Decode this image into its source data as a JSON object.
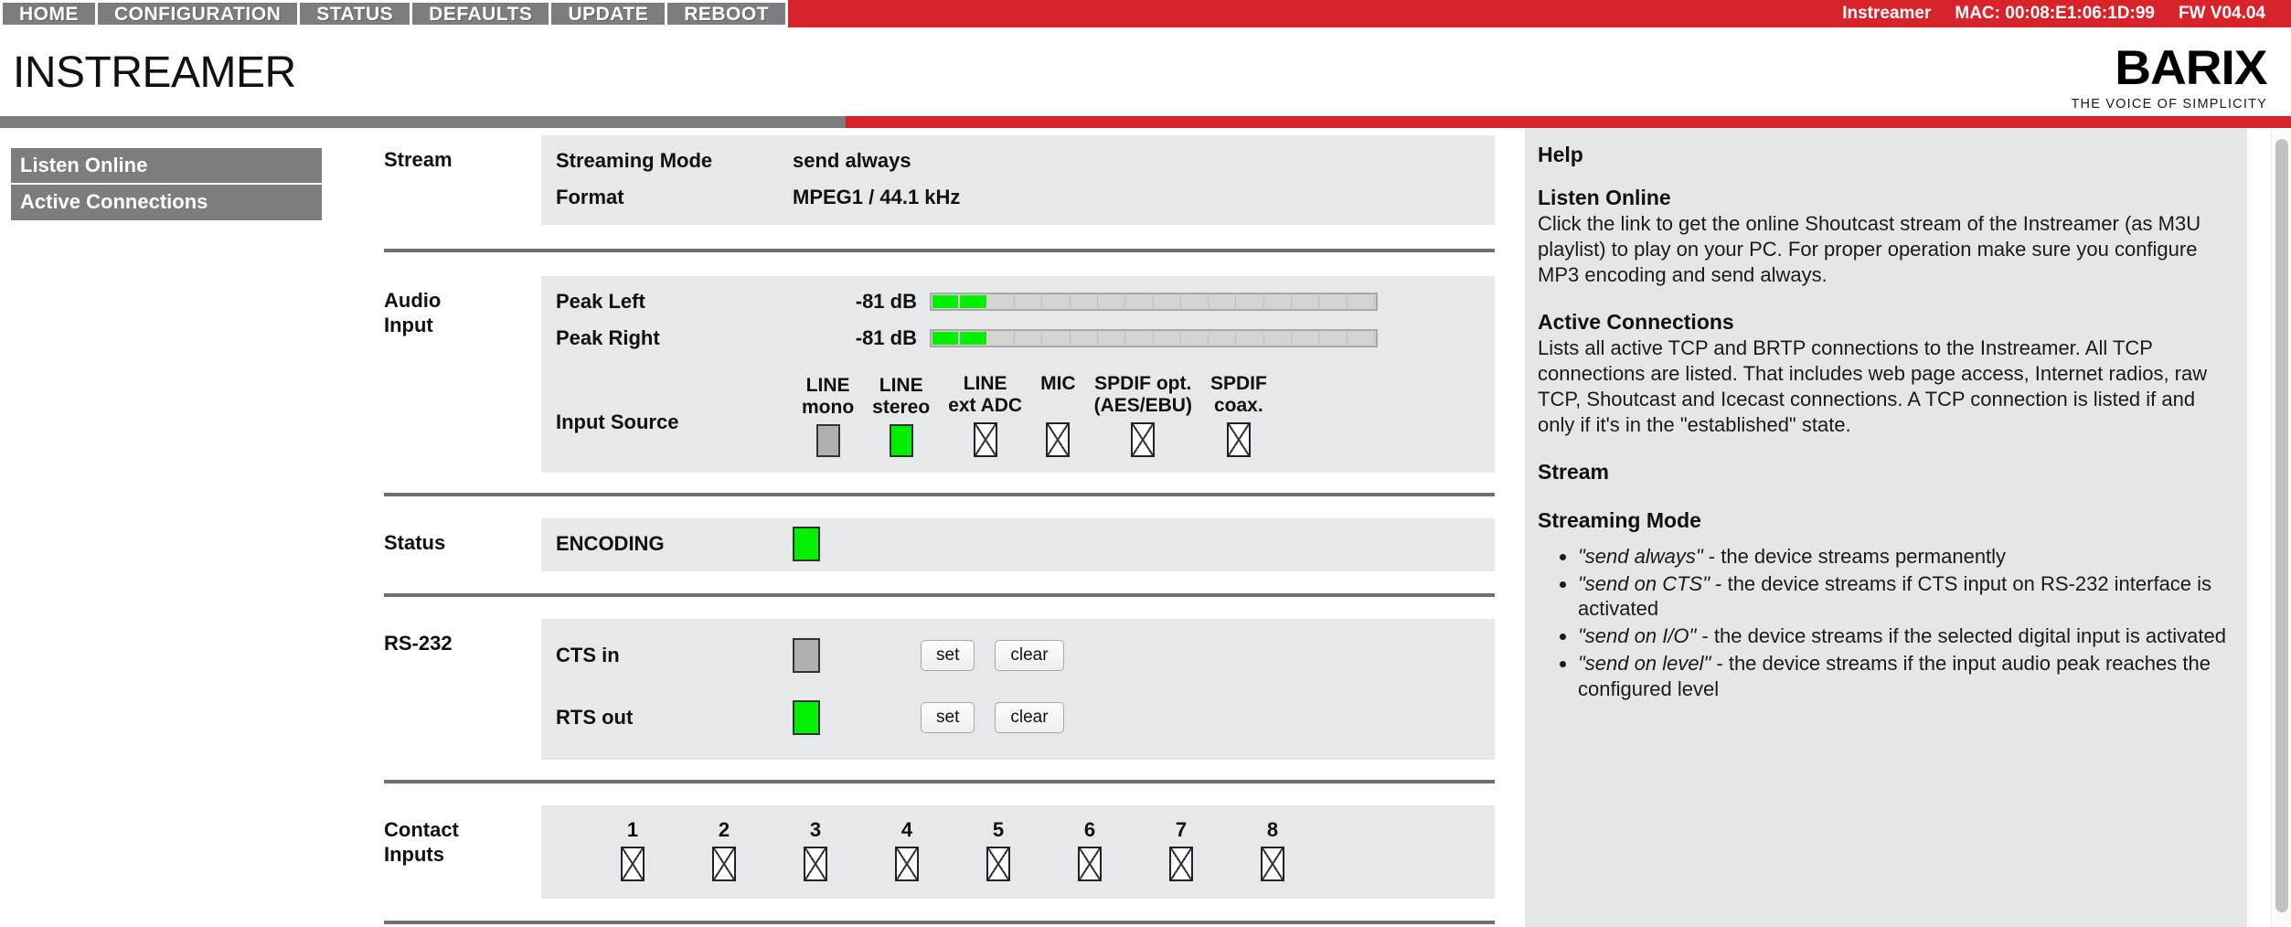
{
  "topnav": {
    "items": [
      {
        "label": "HOME"
      },
      {
        "label": "CONFIGURATION"
      },
      {
        "label": "STATUS"
      },
      {
        "label": "DEFAULTS"
      },
      {
        "label": "UPDATE"
      },
      {
        "label": "REBOOT"
      }
    ],
    "device_name": "Instreamer",
    "mac": "MAC: 00:08:E1:06:1D:99",
    "firmware": "FW V04.04",
    "bar_color": "#d8232a",
    "nav_color": "#7b7d80"
  },
  "header": {
    "product_title": "INSTREAMER",
    "logo_word": "BARIX",
    "logo_tagline": "THE VOICE OF SIMPLICITY"
  },
  "sidebar": {
    "items": [
      {
        "label": "Listen Online"
      },
      {
        "label": "Active Connections"
      }
    ]
  },
  "stream": {
    "section_label": "Stream",
    "rows": [
      {
        "name": "Streaming Mode",
        "value": "send always"
      },
      {
        "name": "Format",
        "value": "MPEG1 / 44.1 kHz"
      }
    ]
  },
  "audio_input": {
    "section_label_line1": "Audio",
    "section_label_line2": "Input",
    "peak_left": {
      "name": "Peak Left",
      "value": "-81 dB",
      "segments_total": 16,
      "segments_on": 2
    },
    "peak_right": {
      "name": "Peak Right",
      "value": "-81 dB",
      "segments_total": 16,
      "segments_on": 2
    },
    "input_source_label": "Input Source",
    "sources": [
      {
        "line1": "LINE",
        "line2": "mono",
        "state": "gray"
      },
      {
        "line1": "LINE",
        "line2": "stereo",
        "state": "green"
      },
      {
        "line1": "LINE",
        "line2": "ext ADC",
        "state": "missing"
      },
      {
        "line1": "MIC",
        "line2": "",
        "state": "missing"
      },
      {
        "line1": "SPDIF opt.",
        "line2": "(AES/EBU)",
        "state": "missing"
      },
      {
        "line1": "SPDIF",
        "line2": "coax.",
        "state": "missing"
      }
    ]
  },
  "status": {
    "section_label": "Status",
    "name": "ENCODING",
    "state": "green"
  },
  "rs232": {
    "section_label": "RS-232",
    "rows": [
      {
        "name": "CTS in",
        "state": "gray",
        "set_label": "set",
        "clear_label": "clear"
      },
      {
        "name": "RTS out",
        "state": "green",
        "set_label": "set",
        "clear_label": "clear"
      }
    ]
  },
  "contact_inputs": {
    "section_label_line1": "Contact",
    "section_label_line2": "Inputs",
    "numbers": [
      "1",
      "2",
      "3",
      "4",
      "5",
      "6",
      "7",
      "8"
    ]
  },
  "help": {
    "title": "Help",
    "sections": [
      {
        "heading": "Listen Online",
        "body": "Click the link to get the online Shoutcast stream of the Instreamer (as M3U playlist) to play on your PC. For proper operation make sure you configure MP3 encoding and send always."
      },
      {
        "heading": "Active Connections",
        "body": "Lists all active TCP and BRTP connections to the Instreamer. All TCP connections are listed. That includes web page access, Internet radios, raw TCP, Shoutcast and Icecast connections. A TCP connection is listed if and only if it's in the \"established\" state."
      },
      {
        "heading": "Stream",
        "body": ""
      },
      {
        "heading": "Streaming Mode",
        "body": ""
      }
    ],
    "streaming_mode_bullets": [
      {
        "quoted": "\"send always\"",
        "rest": " - the device streams permanently"
      },
      {
        "quoted": "\"send on CTS\"",
        "rest": " - the device streams if CTS input on RS-232 interface is activated"
      },
      {
        "quoted": "\"send on I/O\"",
        "rest": " - the device streams if the selected digital input is activated"
      },
      {
        "quoted": "\"send on level\"",
        "rest": " - the device streams if the input audio peak reaches the configured level"
      }
    ]
  }
}
